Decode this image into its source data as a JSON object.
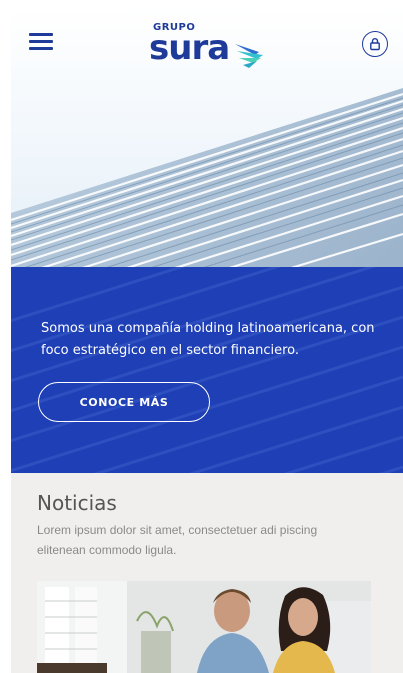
{
  "header": {
    "menu_icon": "hamburger-menu-icon",
    "logo": {
      "small": "GRUPO",
      "main": "sura"
    },
    "user_icon": "user-lock-icon"
  },
  "hero": {
    "text": "Somos una compañía holding latinoamericana, con foco estratégico en el sector financiero.",
    "cta_label": "CONOCE MÁS"
  },
  "news": {
    "title": "Noticias",
    "description": "Lorem ipsum dolor sit amet, consectetuer adi piscing elitenean commodo ligula."
  },
  "colors": {
    "brand_blue": "#1f3b9a",
    "band_blue": "#1e3fb5",
    "logo_accent": "#33c1d1",
    "news_bg": "#f0efed"
  }
}
